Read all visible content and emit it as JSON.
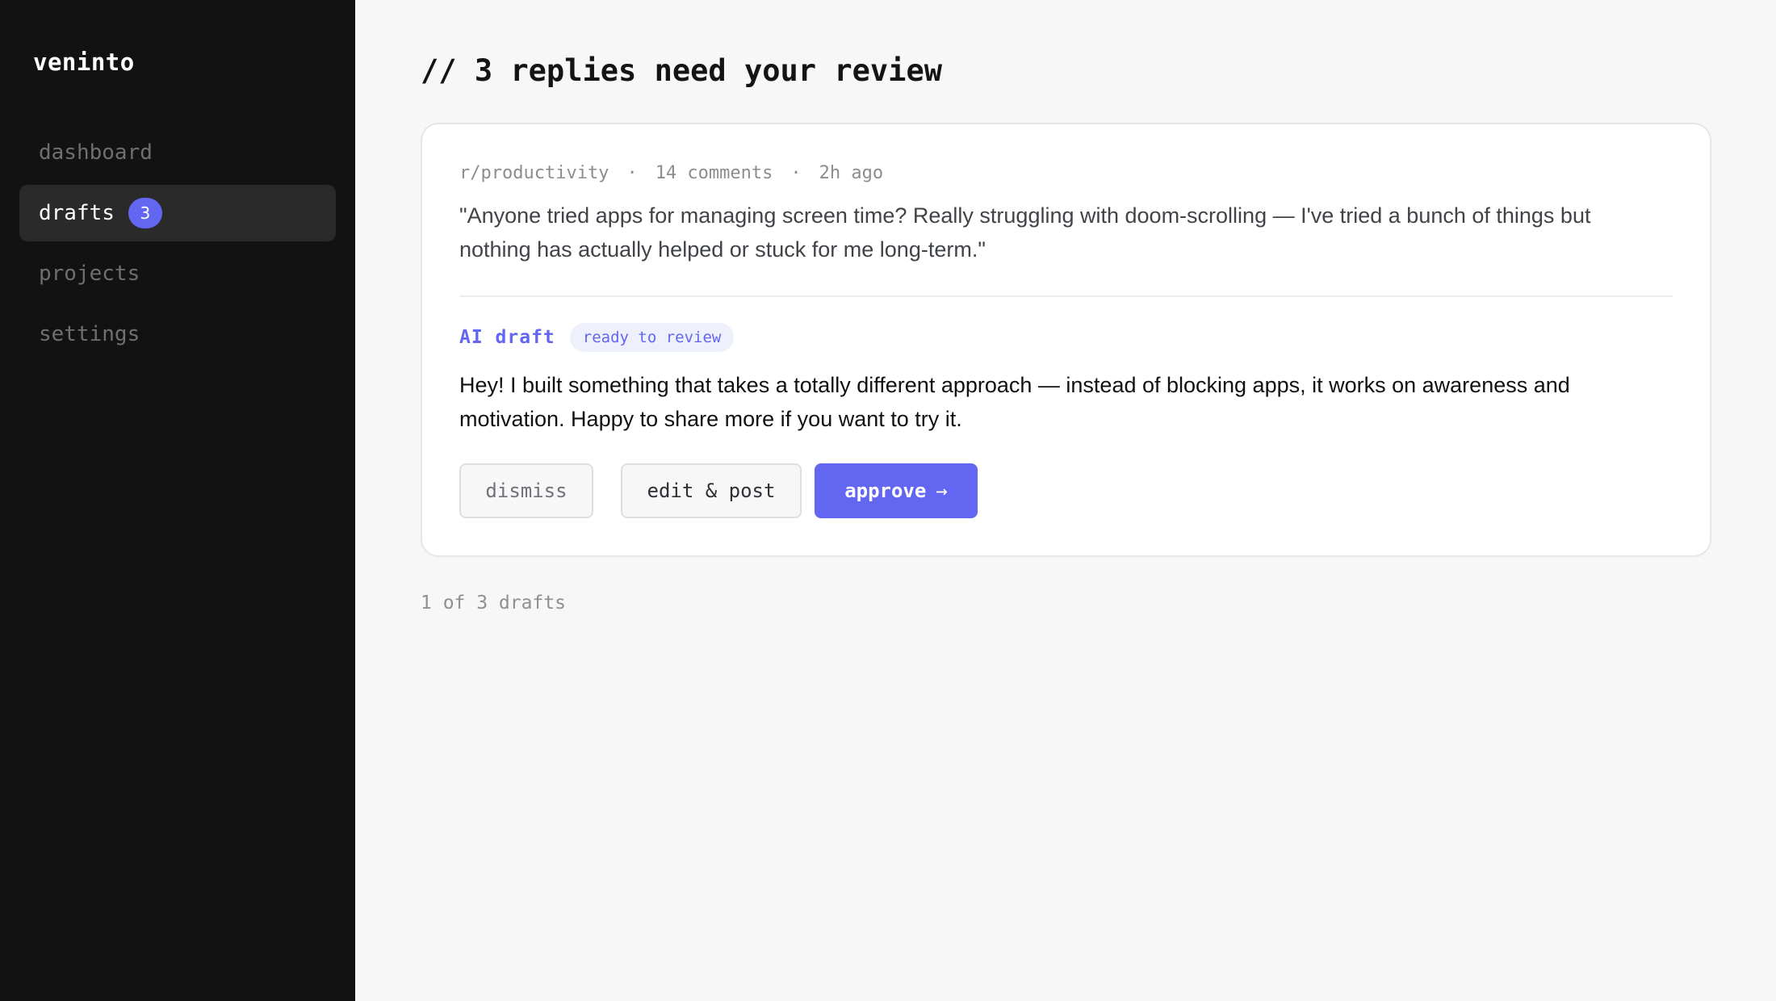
{
  "brand": "veninto",
  "nav": {
    "dashboard": "dashboard",
    "drafts": "drafts",
    "drafts_badge": "3",
    "projects": "projects",
    "settings": "settings"
  },
  "page_title": "// 3 replies need your review",
  "card": {
    "meta": {
      "subreddit": "r/productivity",
      "separator": "·",
      "comments": "14 comments",
      "time": "2h ago"
    },
    "post_text": "\"Anyone tried apps for managing screen time? Really struggling with doom-scrolling — I've tried a bunch of things but nothing has actually helped or stuck for me long-term.\"",
    "draft_label": "AI draft",
    "draft_status": "ready to review",
    "draft_text": "Hey! I built something that takes a totally different approach — instead of blocking apps, it works on awareness and motivation. Happy to share more if you want to try it.",
    "buttons": {
      "dismiss": "dismiss",
      "edit": "edit & post",
      "approve": "approve",
      "approve_arrow": "→"
    }
  },
  "pager": "1 of 3 drafts",
  "colors": {
    "accent": "#6366f1",
    "sidebar_bg": "#121212",
    "page_bg": "#f7f7f7"
  }
}
